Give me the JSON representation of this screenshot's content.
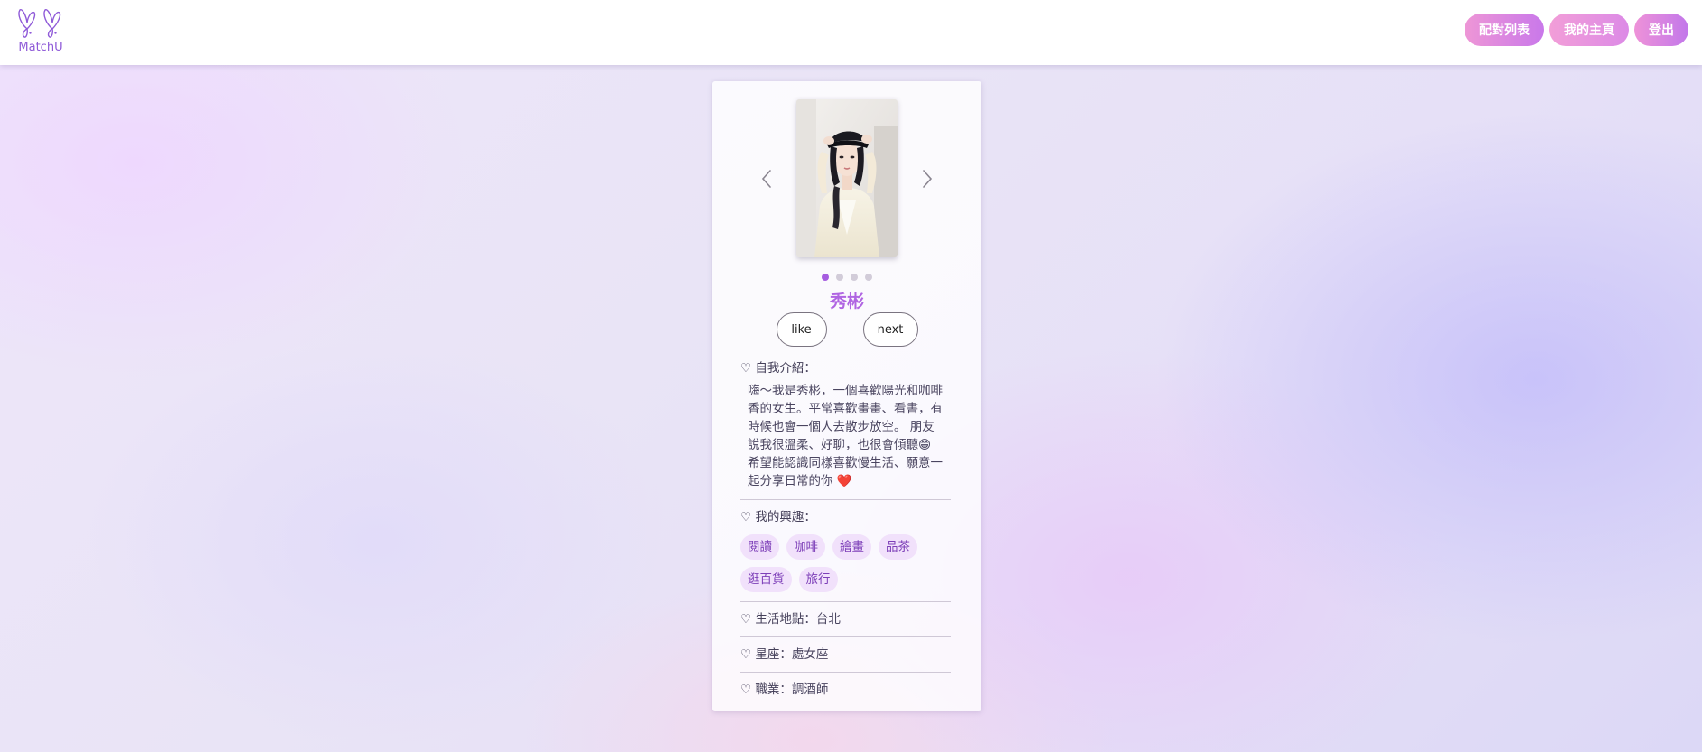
{
  "app": {
    "name": "MatchU"
  },
  "nav": {
    "match_list": "配對列表",
    "my_home": "我的主頁",
    "logout": "登出"
  },
  "profile": {
    "name": "秀彬",
    "photo_count": 4,
    "active_photo": 1,
    "like_label": "like",
    "next_label": "next",
    "intro_label": "♡ 自我介紹：",
    "intro_lines": [
      "嗨～我是秀彬，一個喜歡陽光和咖啡",
      "香的女生。平常喜歡畫畫、看書，有",
      "時候也會一個人去散步放空。 朋友",
      "說我很溫柔、好聊，也很會傾聽😁",
      "希望能認識同樣喜歡慢生活、願意一",
      "起分享日常的你 ❤️"
    ],
    "interests_label": "♡ 我的興趣：",
    "interests": [
      "閱讀",
      "咖啡",
      "繪畫",
      "品茶",
      "逛百貨",
      "旅行"
    ],
    "location_label": "♡ 生活地點：",
    "location": "台北",
    "zodiac_label": "♡ 星座：",
    "zodiac": "處女座",
    "job_label": "♡ 職業：",
    "job": "調酒師"
  },
  "icons": {
    "logo": "butterfly-logo-icon",
    "prev": "chevron-left-icon",
    "next": "chevron-right-icon"
  },
  "colors": {
    "accent": "#b065e2",
    "tag_bg": "#f1e1fb",
    "tag_text": "#7d3fb8"
  }
}
